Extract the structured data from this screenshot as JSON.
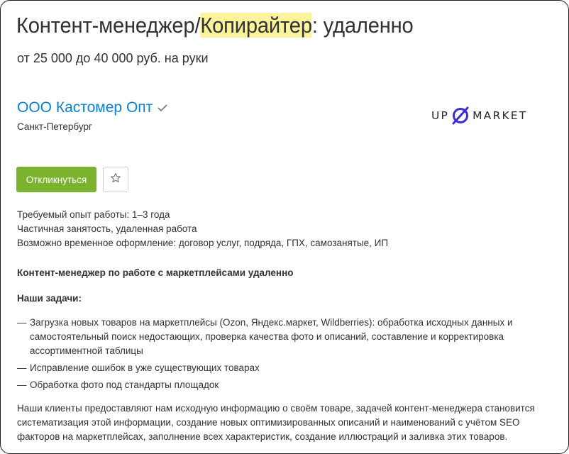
{
  "vacancy": {
    "title_prefix": "Контент-менеджер/",
    "title_highlight": "Копирайтер",
    "title_suffix": ": удаленно",
    "salary": "от 25 000 до 40 000 руб. на руки"
  },
  "company": {
    "name": "ООО Кастомер Опт",
    "verified_icon": "check-icon",
    "city": "Санкт-Петербург",
    "logo": {
      "left_text": "UP",
      "right_text": "MARKET",
      "accent": "#3c2bd6"
    }
  },
  "actions": {
    "apply_label": "Откликнуться",
    "favorite_icon": "star-icon",
    "apply_color": "#7bb32e"
  },
  "details": [
    "Требуемый опыт работы: 1–3 года",
    "Частичная занятость, удаленная работа",
    "Возможно временное оформление: договор услуг, подряда, ГПХ, самозанятые, ИП"
  ],
  "description": {
    "heading": "Контент-менеджер по работе с маркетплейсами удаленно",
    "tasks_heading": "Наши задачи:",
    "tasks": [
      "Загрузка новых товаров на маркетплейсы (Ozon, Яндекс.маркет, Wildberries): обработка исходных данных и самостоятельный поиск недостающих, проверка качества фото и описаний, составление и корректировка ассортиментной таблицы",
      "Исправление ошибок в уже существующих товарах",
      "Обработка фото под стандарты площадок"
    ],
    "dash": "—",
    "paragraph": "Наши клиенты предоставляют нам исходную информацию о своём товаре, задачей контент-менеджера становится систематизация этой информации, создание новых оптимизированных описаний и наименований с учётом SEO факторов на маркетплейсах, заполнение всех характеристик, создание иллюстраций и заливка этих товаров."
  }
}
